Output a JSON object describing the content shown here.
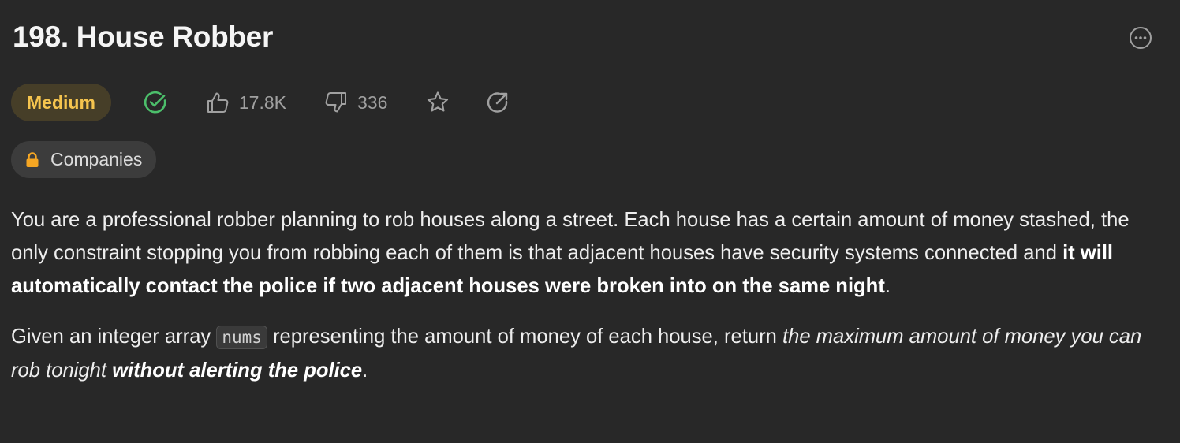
{
  "problem": {
    "title": "198. House Robber",
    "difficulty": "Medium",
    "likes": "17.8K",
    "dislikes": "336",
    "tag_companies": "Companies"
  },
  "description": {
    "p1_text": "You are a professional robber planning to rob houses along a street. Each house has a certain amount of money stashed, the only constraint stopping you from robbing each of them is that adjacent houses have security systems connected and ",
    "p1_bold": "it will automatically contact the police if two adjacent houses were broken into on the same night",
    "p1_end": ".",
    "p2_text_a": "Given an integer array ",
    "p2_code": "nums",
    "p2_text_b": " representing the amount of money of each house, return ",
    "p2_italic": "the maximum amount of money you can rob tonight ",
    "p2_bold_italic": "without alerting the police",
    "p2_end": "."
  },
  "colors": {
    "background": "#282828",
    "difficulty_bg": "#463e28",
    "difficulty_text": "#f5c44e",
    "solved_check": "#4cbf6b",
    "lock": "#f5a623"
  },
  "icons": [
    "more-icon",
    "solved-check-icon",
    "thumbs-up-icon",
    "thumbs-down-icon",
    "star-icon",
    "share-icon",
    "lock-icon"
  ]
}
